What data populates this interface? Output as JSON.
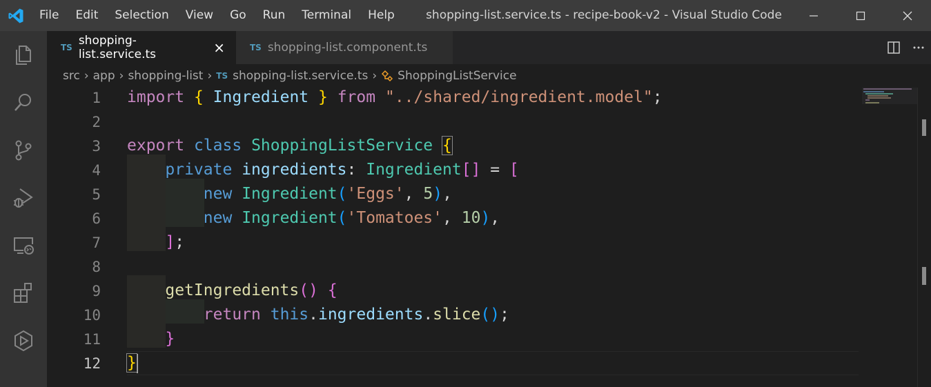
{
  "window": {
    "title": "shopping-list.service.ts - recipe-book-v2 - Visual Studio Code",
    "menu": [
      "File",
      "Edit",
      "Selection",
      "View",
      "Go",
      "Run",
      "Terminal",
      "Help"
    ]
  },
  "activity_bar": {
    "items": [
      "files-icon",
      "search-icon",
      "source-control-icon",
      "run-debug-icon",
      "remote-explorer-icon",
      "extensions-icon",
      "live-share-icon"
    ]
  },
  "tabs": [
    {
      "badge": "TS",
      "label": "shopping-list.service.ts",
      "active": true
    },
    {
      "badge": "TS",
      "label": "shopping-list.component.ts",
      "active": false
    }
  ],
  "breadcrumb": {
    "parts": [
      "src",
      "app",
      "shopping-list"
    ],
    "file_badge": "TS",
    "file": "shopping-list.service.ts",
    "symbol": "ShoppingListService"
  },
  "editor": {
    "line_numbers": [
      "1",
      "2",
      "3",
      "4",
      "5",
      "6",
      "7",
      "8",
      "9",
      "10",
      "11",
      "12"
    ],
    "current_line": 12
  },
  "colors": {
    "keyword": "#c586c0",
    "storage": "#569cd6",
    "class": "#4ec9b0",
    "string": "#ce9178",
    "number": "#b5cea8",
    "function": "#dcdcaa"
  }
}
